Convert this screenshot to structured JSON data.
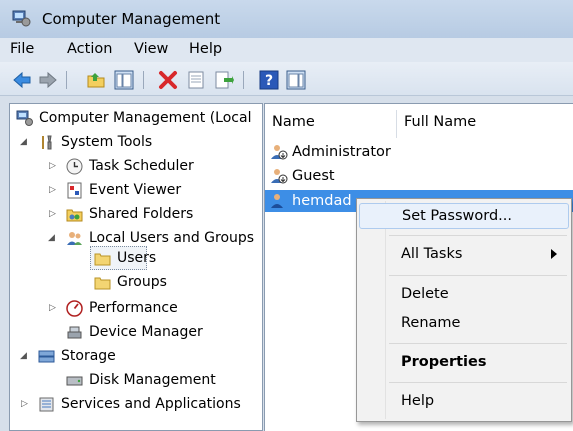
{
  "window": {
    "title": "Computer Management"
  },
  "menu": [
    "File",
    "Action",
    "View",
    "Help"
  ],
  "toolbar": {
    "buttons": [
      "back-arrow-icon",
      "forward-arrow-icon",
      "up-folder-icon",
      "show-hide-console-tree-icon",
      "delete-icon",
      "properties-icon",
      "export-list-icon",
      "help-icon",
      "action-pane-icon"
    ]
  },
  "tree": {
    "root": "Computer Management (Local",
    "system_tools": "System Tools",
    "task_scheduler": "Task Scheduler",
    "event_viewer": "Event Viewer",
    "shared_folders": "Shared Folders",
    "local_users_groups": "Local Users and Groups",
    "users": "Users",
    "groups": "Groups",
    "performance": "Performance",
    "device_manager": "Device Manager",
    "storage": "Storage",
    "disk_management": "Disk Management",
    "services_apps": "Services and Applications"
  },
  "list": {
    "columns": [
      "Name",
      "Full Name"
    ],
    "rows": [
      "Administrator",
      "Guest",
      "hemdad"
    ]
  },
  "context_menu": {
    "set_password": "Set Password...",
    "all_tasks": "All Tasks",
    "delete": "Delete",
    "rename": "Rename",
    "properties": "Properties",
    "help": "Help"
  }
}
